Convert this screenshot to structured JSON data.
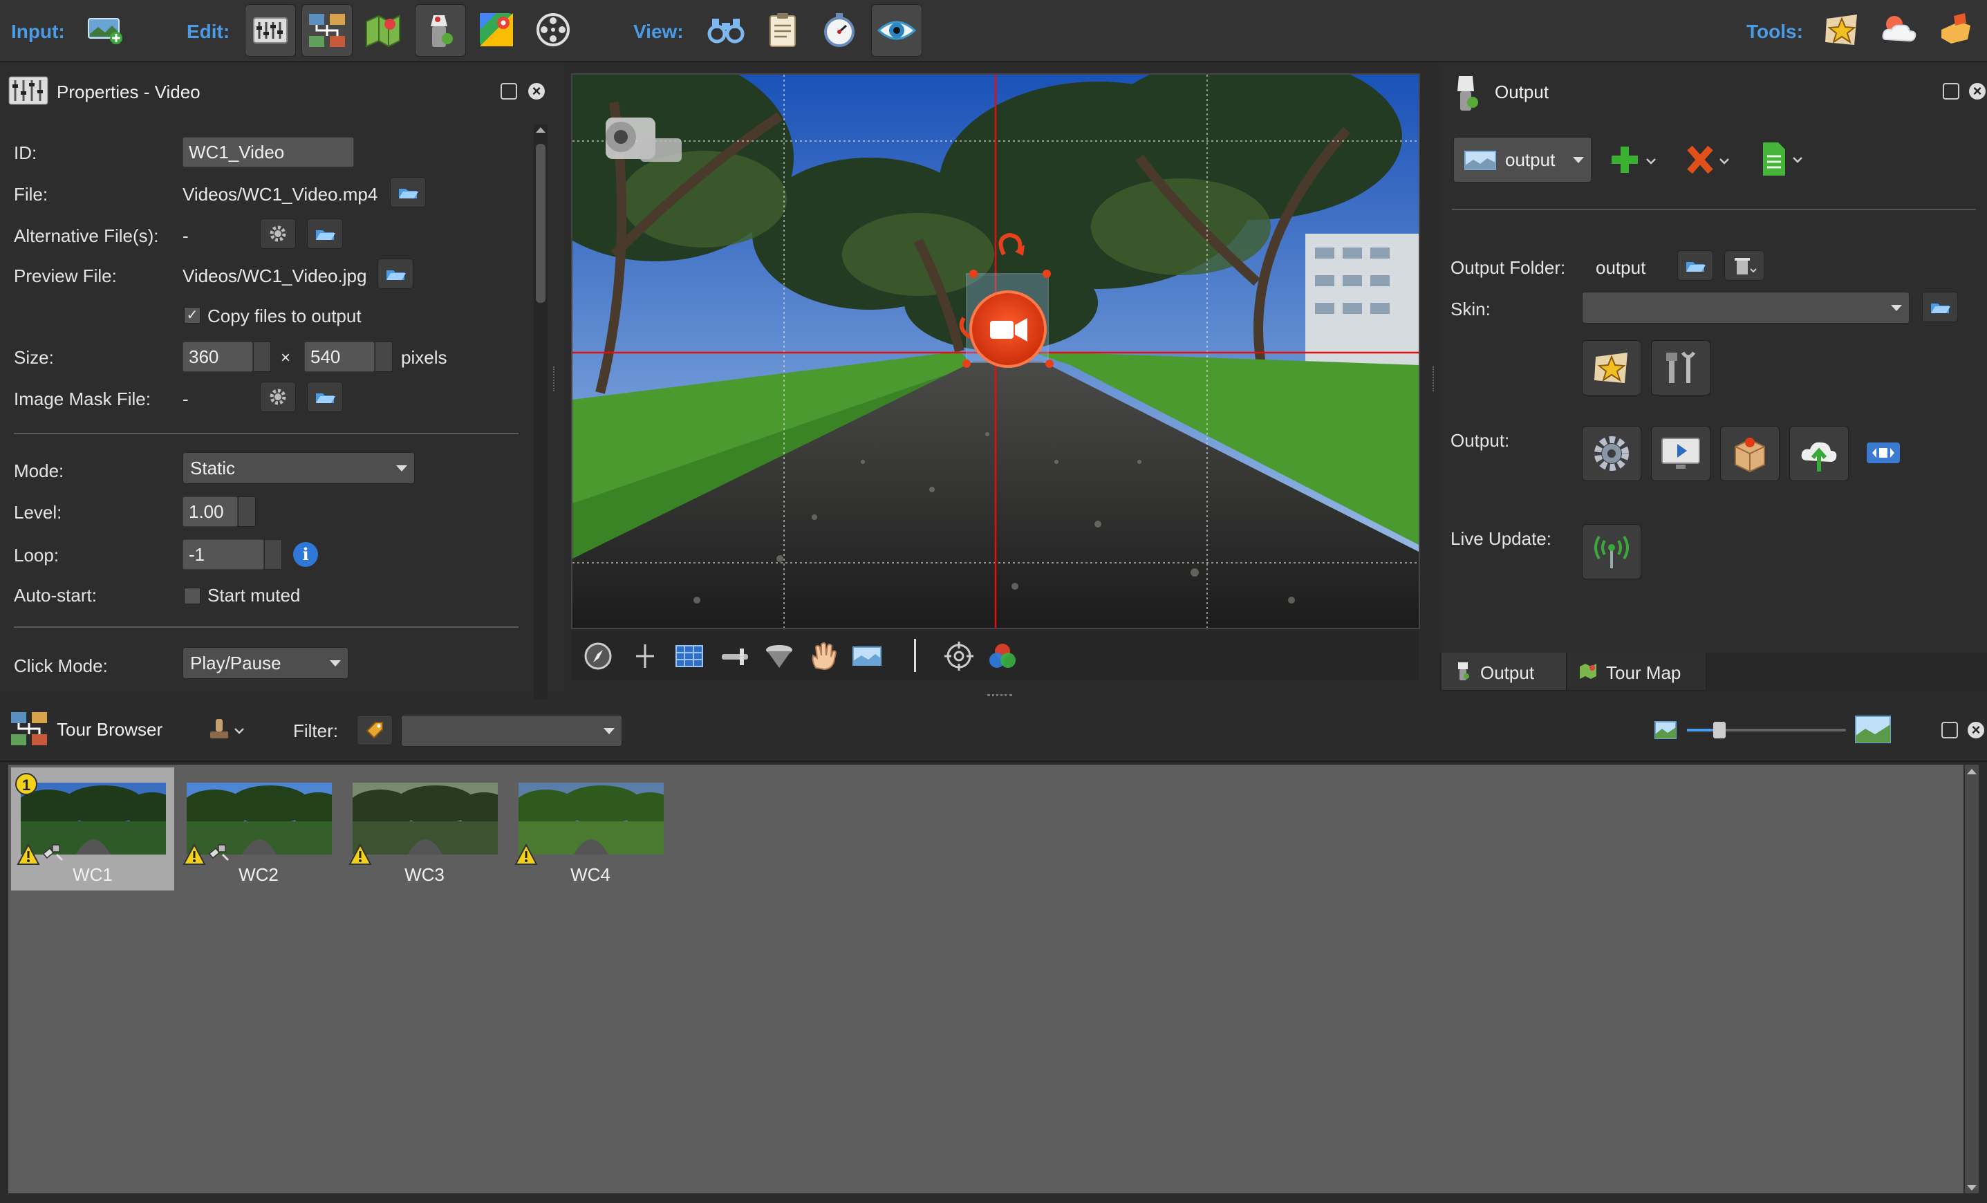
{
  "toolbar": {
    "input_label": "Input:",
    "edit_label": "Edit:",
    "view_label": "View:",
    "tools_label": "Tools:"
  },
  "properties": {
    "title": "Properties - Video",
    "id_label": "ID:",
    "id_value": "WC1_Video",
    "file_label": "File:",
    "file_value": "Videos/WC1_Video.mp4",
    "alt_label": "Alternative File(s):",
    "alt_value": "-",
    "preview_label": "Preview File:",
    "preview_value": "Videos/WC1_Video.jpg",
    "copy_label": "Copy files to output",
    "copy_checked": true,
    "size_label": "Size:",
    "width": "360",
    "times": "×",
    "height": "540",
    "pixels": "pixels",
    "mask_label": "Image Mask File:",
    "mask_value": "-",
    "mode_label": "Mode:",
    "mode_value": "Static",
    "level_label": "Level:",
    "level_value": "1.00",
    "loop_label": "Loop:",
    "loop_value": "-1",
    "autostart_label": "Auto-start:",
    "muted_label": "Start muted",
    "muted_checked": false,
    "click_label": "Click Mode:",
    "click_value": "Play/Pause"
  },
  "output": {
    "title": "Output",
    "combo_value": "output",
    "folder_label": "Output Folder:",
    "folder_value": "output",
    "skin_label": "Skin:",
    "skin_value": "",
    "output_label": "Output:",
    "live_label": "Live Update:",
    "tabs": [
      "Output",
      "Tour Map"
    ]
  },
  "browser": {
    "title": "Tour Browser",
    "filter_label": "Filter:",
    "filter_value": "",
    "thumbnails": [
      {
        "label": "WC1",
        "selected": true,
        "badge": "1",
        "warning": true,
        "gps": true
      },
      {
        "label": "WC2",
        "selected": false,
        "badge": "",
        "warning": true,
        "gps": true
      },
      {
        "label": "WC3",
        "selected": false,
        "badge": "",
        "warning": true,
        "gps": false
      },
      {
        "label": "WC4",
        "selected": false,
        "badge": "",
        "warning": true,
        "gps": false
      }
    ]
  },
  "colors": {
    "accent_blue": "#4a9be8",
    "guide_red": "#e01010",
    "video_red": "#e23b14",
    "background": "#2b2b2b"
  }
}
